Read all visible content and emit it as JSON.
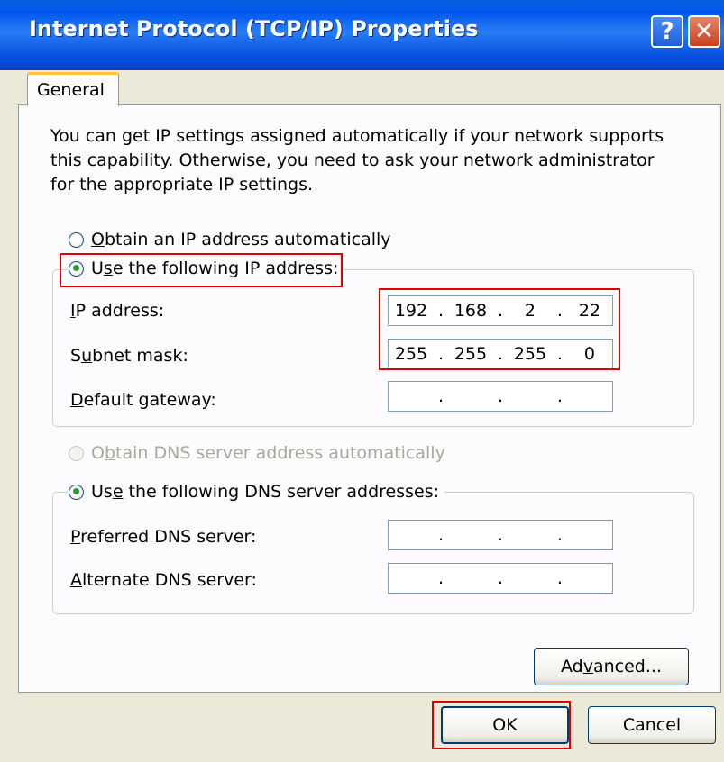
{
  "window": {
    "title": "Internet Protocol (TCP/IP) Properties",
    "help_glyph": "?",
    "close_glyph": "✕"
  },
  "tabs": [
    {
      "label": "General",
      "active": true
    }
  ],
  "description": "You can get IP settings assigned automatically if your network supports this capability. Otherwise, you need to ask your network administrator for the appropriate IP settings.",
  "ip_section": {
    "auto_option": {
      "pre": "",
      "accel": "O",
      "post": "btain an IP address automatically",
      "checked": false
    },
    "manual_option": {
      "pre": "U",
      "accel": "s",
      "post": "e the following IP address:",
      "checked": true
    },
    "fields": [
      {
        "pre": "",
        "accel": "I",
        "post": "P address:",
        "octets": [
          "192",
          "168",
          "2",
          "22"
        ]
      },
      {
        "pre": "S",
        "accel": "u",
        "post": "bnet mask:",
        "octets": [
          "255",
          "255",
          "255",
          "0"
        ]
      },
      {
        "pre": "",
        "accel": "D",
        "post": "efault gateway:",
        "octets": [
          "",
          "",
          "",
          ""
        ]
      }
    ]
  },
  "dns_section": {
    "auto_option": {
      "pre": "O",
      "accel": "b",
      "post": "tain DNS server address automatically",
      "checked": false,
      "disabled": true
    },
    "manual_option": {
      "pre": "Us",
      "accel": "e",
      "post": " the following DNS server addresses:",
      "checked": true
    },
    "fields": [
      {
        "pre": "",
        "accel": "P",
        "post": "referred DNS server:",
        "octets": [
          "",
          "",
          "",
          ""
        ]
      },
      {
        "pre": "",
        "accel": "A",
        "post": "lternate DNS server:",
        "octets": [
          "",
          "",
          "",
          ""
        ]
      }
    ]
  },
  "buttons": {
    "advanced": {
      "pre": "Ad",
      "accel": "v",
      "post": "anced..."
    },
    "ok": "OK",
    "cancel": "Cancel"
  },
  "colors": {
    "titlebar": "#0058EE",
    "dialog_bg": "#ECE9D8",
    "highlight": "#E00000",
    "radio_checked": "#21A121"
  }
}
